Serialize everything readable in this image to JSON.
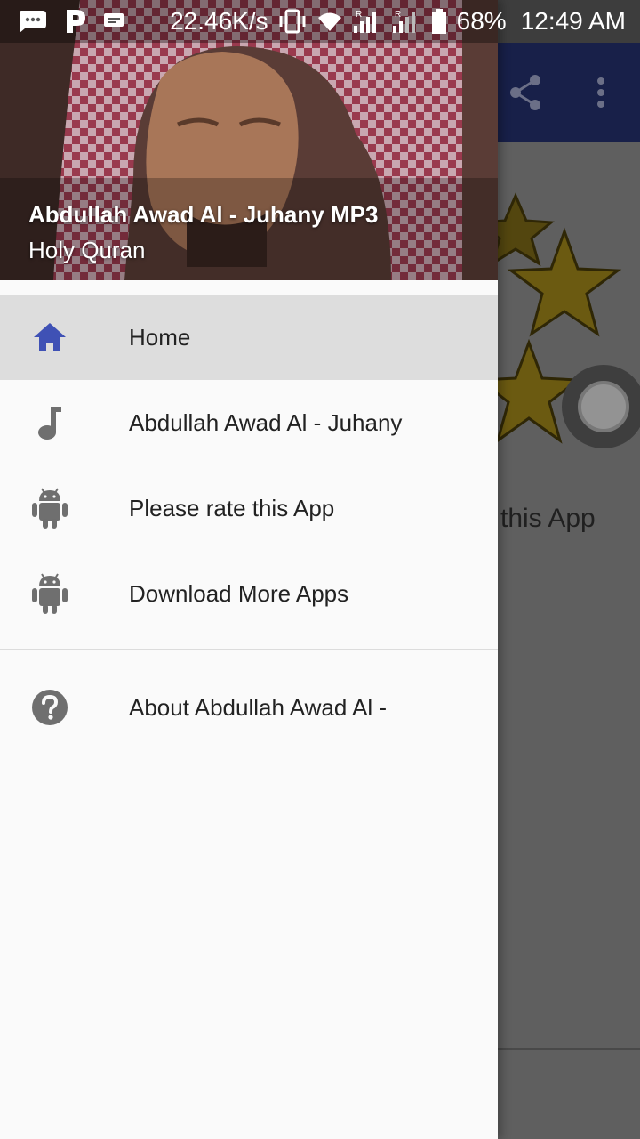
{
  "status_bar": {
    "net_speed": "22.46K/s",
    "battery": "68%",
    "time": "12:49 AM"
  },
  "drawer": {
    "header": {
      "title": "Abdullah Awad Al - Juhany MP3",
      "subtitle": "Holy Quran"
    },
    "items": [
      {
        "label": "Home",
        "icon": "home-icon",
        "selected": true
      },
      {
        "label": "Abdullah Awad Al - Juhany",
        "icon": "music-note-icon"
      },
      {
        "label": "Please rate this App",
        "icon": "android-icon"
      },
      {
        "label": "Download More Apps",
        "icon": "android-icon"
      }
    ],
    "secondary_items": [
      {
        "label": "About Abdullah Awad Al -",
        "icon": "help-icon"
      }
    ]
  },
  "background": {
    "rate_text": "this App"
  },
  "colors": {
    "toolbar": "#1f2a5e",
    "home_icon": "#3f51b5",
    "drawer_bg": "#fafafa",
    "selected_bg": "#dddddd"
  }
}
